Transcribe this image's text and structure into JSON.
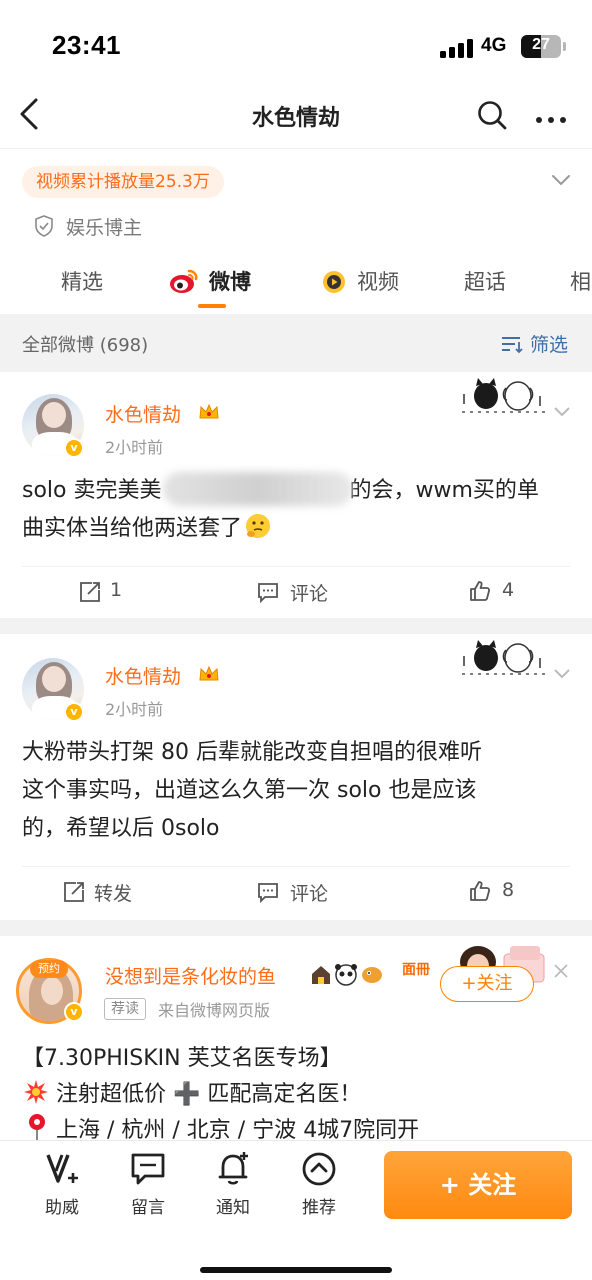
{
  "status_bar": {
    "time": "23:41",
    "network": "4G",
    "battery": "27"
  },
  "nav": {
    "title": "水色情劫"
  },
  "profile": {
    "play_count_badge": "视频累计播放量25.3万",
    "verify_label": "娱乐博主"
  },
  "tabs": [
    {
      "label": "精选"
    },
    {
      "label": "微博"
    },
    {
      "label": "视频"
    },
    {
      "label": "超话"
    },
    {
      "label": "相"
    }
  ],
  "filter_bar": {
    "count_label": "全部微博 (698)",
    "filter_label": "筛选"
  },
  "posts": [
    {
      "username": "水色情劫",
      "time": "2小时前",
      "text_line1_a": "solo 卖完美美",
      "text_line1_b": "的会，wwm买的单",
      "text_line2": "曲实体当给他两送套了",
      "repost": "1",
      "comment": "评论",
      "like": "4"
    },
    {
      "username": "水色情劫",
      "time": "2小时前",
      "text_line1": "大粉带头打架 80 后辈就能改变自担唱的很难听",
      "text_line2": "这个事实吗，出道这么久第一次 solo 也是应该",
      "text_line3": "的，希望以后 0solo",
      "repost": "转发",
      "comment": "评论",
      "like": "8"
    },
    {
      "avatar_badge": "预约",
      "username": "没想到是条化妆的鱼",
      "tag": "荐读",
      "source": "来自微博网页版",
      "follow_label": "+关注",
      "line1": "【7.30PHISKIN 芙艾名医专场】",
      "line2": "注射超低价 ➕ 匹配高定名医！",
      "line3": "上海 / 杭州 / 北京 / 宁波 4城7院同开"
    }
  ],
  "toolbar": {
    "items": [
      {
        "label": "助威",
        "icon": "v-plus-icon"
      },
      {
        "label": "留言",
        "icon": "message-icon"
      },
      {
        "label": "通知",
        "icon": "bell-icon"
      },
      {
        "label": "推荐",
        "icon": "recommend-icon"
      }
    ],
    "follow_button": "+ 关注"
  },
  "colors": {
    "accent": "#ff8200",
    "username": "#ff6c1a",
    "link": "#3d6fa8"
  }
}
